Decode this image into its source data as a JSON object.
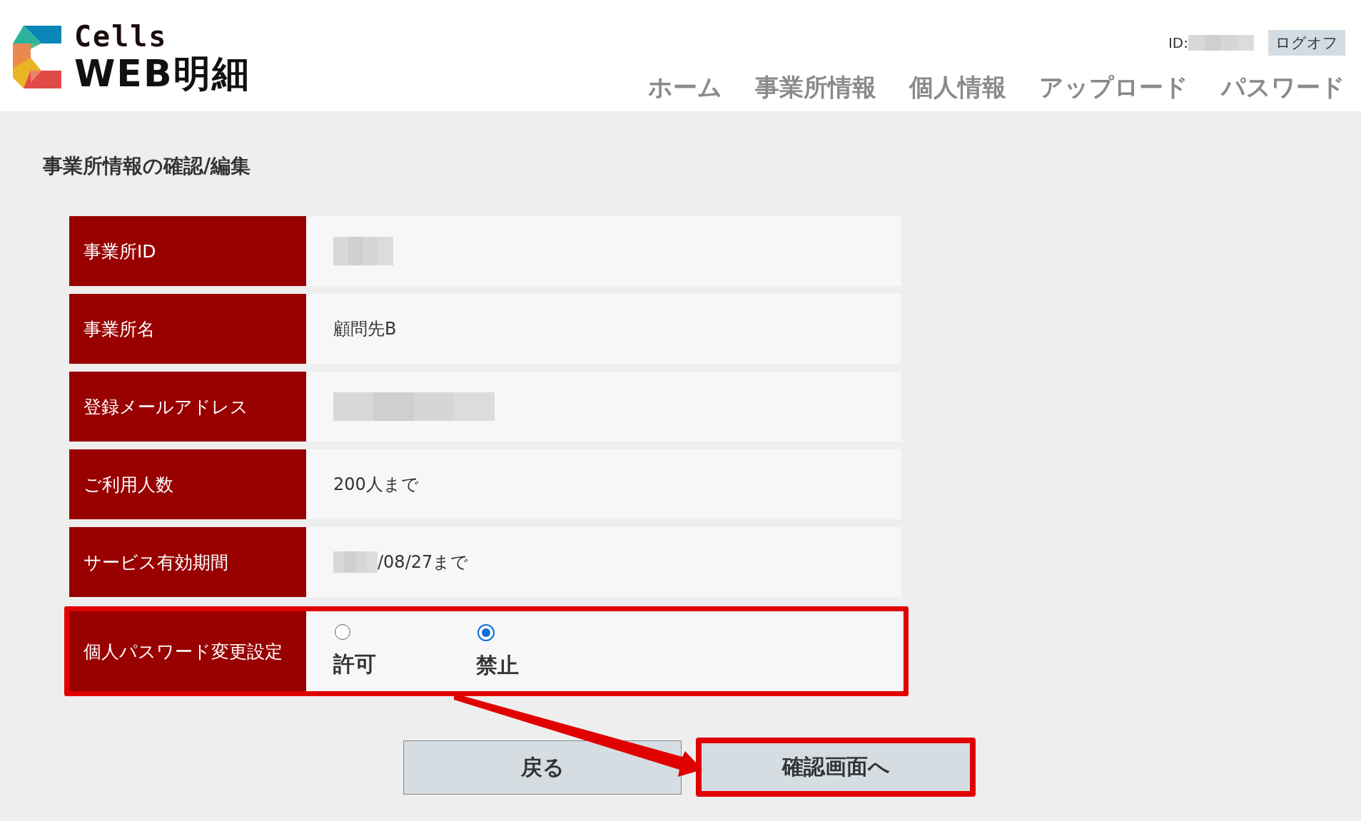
{
  "header": {
    "logo": {
      "line1": "Cells",
      "line2": "WEB明細"
    },
    "user_id": {
      "label": "ID:",
      "redacted": true
    },
    "logoff_button": "ログオフ",
    "nav": [
      {
        "label": "ホーム",
        "selected": false
      },
      {
        "label": "事業所情報",
        "selected": false
      },
      {
        "label": "個人情報",
        "selected": false
      },
      {
        "label": "アップロード",
        "selected": false
      },
      {
        "label": "パスワード",
        "selected": false
      }
    ]
  },
  "page_title": "事業所情報の確認/編集",
  "form": {
    "rows": [
      {
        "label": "事業所ID",
        "kind": "text",
        "redacted": true,
        "highlighted": false
      },
      {
        "label": "事業所名",
        "kind": "text",
        "value": "顧問先B",
        "redacted": false,
        "highlighted": false
      },
      {
        "label": "登録メールアドレス",
        "kind": "text",
        "redacted": true,
        "highlighted": false
      },
      {
        "label": "ご利用人数",
        "kind": "text",
        "value": "200人まで",
        "redacted": false,
        "highlighted": false
      },
      {
        "label": "サービス有効期間",
        "kind": "text",
        "value": "/08/27まで",
        "redacted": true,
        "highlighted": false
      },
      {
        "label": "個人パスワード変更設定",
        "kind": "radio",
        "options": [
          {
            "label": "許可",
            "selected": false
          },
          {
            "label": "禁止",
            "selected": true
          }
        ],
        "highlighted": true
      }
    ]
  },
  "buttons": [
    {
      "label": "戻る",
      "highlighted": false
    },
    {
      "label": "確認画面へ",
      "highlighted": true
    }
  ]
}
